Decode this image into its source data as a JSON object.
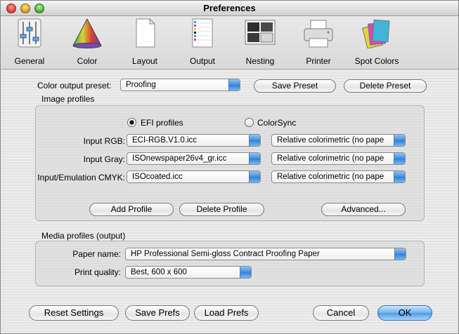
{
  "window": {
    "title": "Preferences"
  },
  "toolbar": {
    "items": [
      {
        "label": "General",
        "icon": "sliders-icon"
      },
      {
        "label": "Color",
        "icon": "color-cone-icon"
      },
      {
        "label": "Layout",
        "icon": "page-icon"
      },
      {
        "label": "Output",
        "icon": "output-sheet-icon"
      },
      {
        "label": "Nesting",
        "icon": "nesting-icon"
      },
      {
        "label": "Printer",
        "icon": "printer-icon"
      },
      {
        "label": "Spot Colors",
        "icon": "spot-colors-icon"
      }
    ]
  },
  "preset": {
    "label": "Color output preset:",
    "value": "Proofing",
    "save_label": "Save Preset",
    "delete_label": "Delete Preset"
  },
  "image_profiles": {
    "title": "Image profiles",
    "radio_efi": "EFI profiles",
    "radio_colorsync": "ColorSync",
    "selected": "EFI profiles",
    "rows": [
      {
        "label": "Input RGB:",
        "profile": "ECI-RGB.V1.0.icc",
        "intent": "Relative colorimetric (no pape"
      },
      {
        "label": "Input Gray:",
        "profile": "ISOnewspaper26v4_gr.icc",
        "intent": "Relative colorimetric (no pape"
      },
      {
        "label": "Input/Emulation CMYK:",
        "profile": "ISOcoated.icc",
        "intent": "Relative colorimetric (no pape"
      }
    ],
    "add_label": "Add Profile",
    "delete_label": "Delete Profile",
    "advanced_label": "Advanced..."
  },
  "media_profiles": {
    "title": "Media profiles (output)",
    "paper_label": "Paper name:",
    "paper_value": "HP Professional Semi-gloss Contract Proofing Paper",
    "quality_label": "Print quality:",
    "quality_value": "Best, 600 x 600"
  },
  "footer": {
    "reset_label": "Reset Settings",
    "save_label": "Save Prefs",
    "load_label": "Load Prefs",
    "cancel_label": "Cancel",
    "ok_label": "OK"
  },
  "colors": {
    "close": "#e0443e",
    "minimize": "#e0a02a",
    "zoom": "#57b33b",
    "accent": "#4d9be6"
  }
}
